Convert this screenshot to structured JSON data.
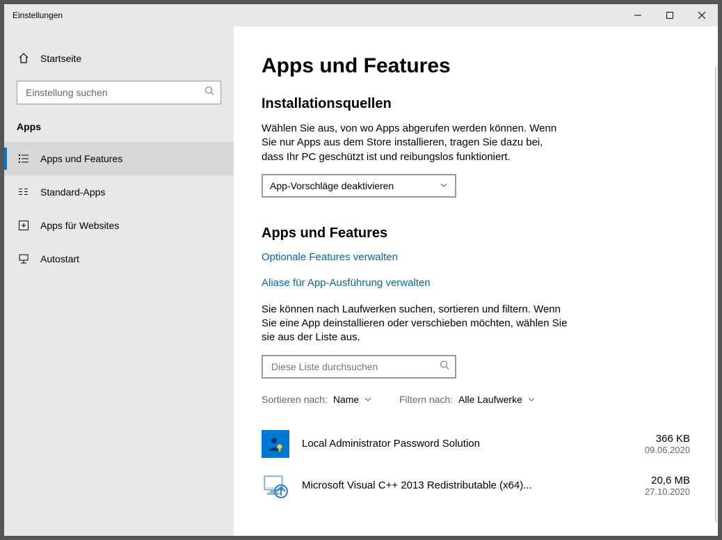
{
  "window": {
    "title": "Einstellungen"
  },
  "sidebar": {
    "home": "Startseite",
    "search_placeholder": "Einstellung suchen",
    "section": "Apps",
    "items": [
      {
        "label": "Apps und Features"
      },
      {
        "label": "Standard-Apps"
      },
      {
        "label": "Apps für Websites"
      },
      {
        "label": "Autostart"
      }
    ]
  },
  "main": {
    "title": "Apps und Features",
    "install_sources": {
      "heading": "Installationsquellen",
      "description": "Wählen Sie aus, von wo Apps abgerufen werden können. Wenn Sie nur Apps aus dem Store installieren, tragen Sie dazu bei, dass Ihr PC geschützt ist und reibungslos funktioniert.",
      "dropdown_value": "App-Vorschläge deaktivieren"
    },
    "apps_section": {
      "heading": "Apps und Features",
      "link_optional": "Optionale Features verwalten",
      "link_aliases": "Aliase für App-Ausführung verwalten",
      "description": "Sie können nach Laufwerken suchen, sortieren und filtern. Wenn Sie eine App deinstallieren oder verschieben möchten, wählen Sie sie aus der Liste aus.",
      "search_placeholder": "Diese Liste durchsuchen",
      "sort_label": "Sortieren nach:",
      "sort_value": "Name",
      "filter_label": "Filtern nach:",
      "filter_value": "Alle Laufwerke",
      "apps": [
        {
          "name": "Local Administrator Password Solution",
          "size": "366 KB",
          "date": "09.06.2020"
        },
        {
          "name": "Microsoft Visual C++ 2013 Redistributable (x64)...",
          "size": "20,6 MB",
          "date": "27.10.2020"
        }
      ]
    }
  }
}
